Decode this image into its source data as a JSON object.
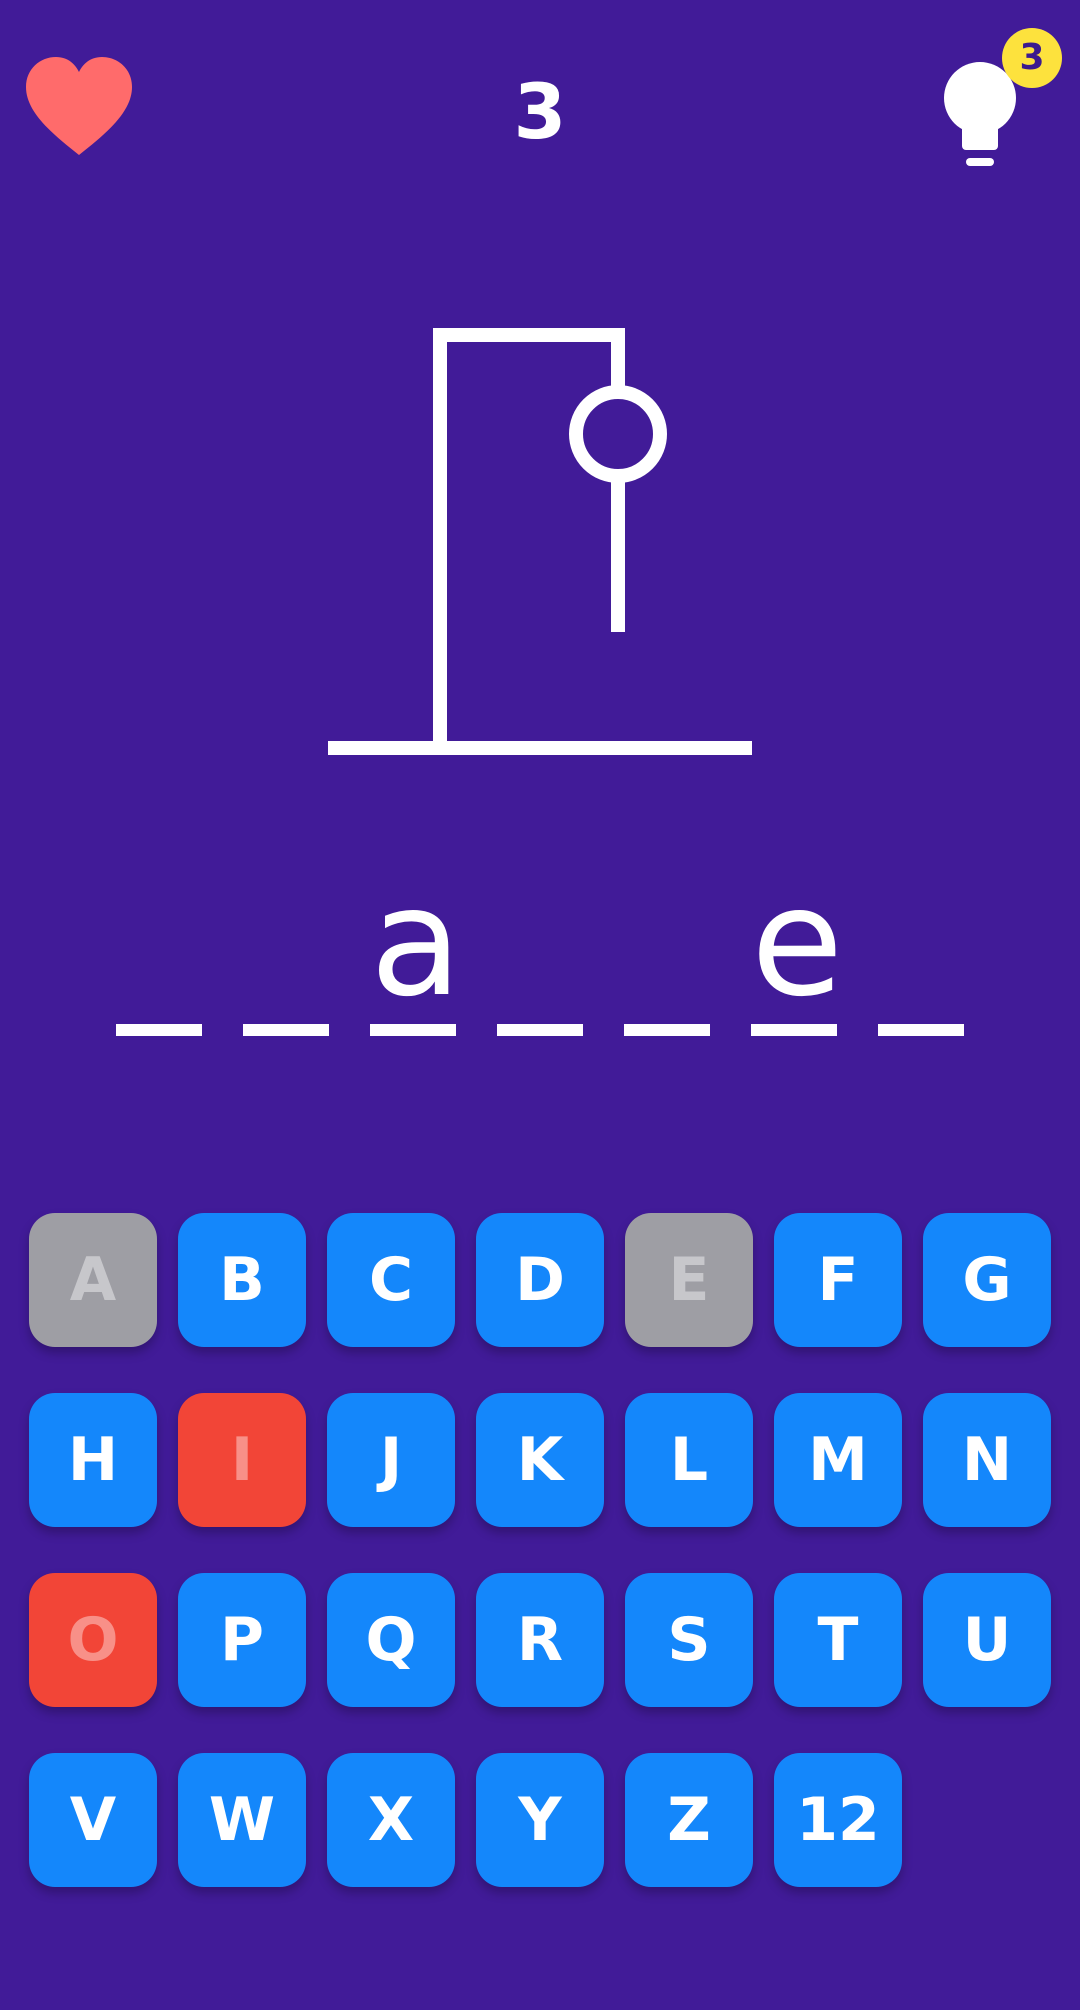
{
  "header": {
    "lives_icon": "heart-icon",
    "level": "3",
    "hint_icon": "lightbulb-icon",
    "hint_count": "3"
  },
  "colors": {
    "background": "#411b98",
    "key_available": "#1487fb",
    "key_revealed": "#9e9ea4",
    "key_wrong": "#f24537",
    "heart": "#ff6b6b",
    "hint_badge": "#fde23d"
  },
  "word": [
    "",
    "",
    "a",
    "",
    "",
    "e",
    ""
  ],
  "keyboard": [
    {
      "label": "A",
      "state": "revealed"
    },
    {
      "label": "B",
      "state": "available"
    },
    {
      "label": "C",
      "state": "available"
    },
    {
      "label": "D",
      "state": "available"
    },
    {
      "label": "E",
      "state": "revealed"
    },
    {
      "label": "F",
      "state": "available"
    },
    {
      "label": "G",
      "state": "available"
    },
    {
      "label": "H",
      "state": "available"
    },
    {
      "label": "I",
      "state": "wrong"
    },
    {
      "label": "J",
      "state": "available"
    },
    {
      "label": "K",
      "state": "available"
    },
    {
      "label": "L",
      "state": "available"
    },
    {
      "label": "M",
      "state": "available"
    },
    {
      "label": "N",
      "state": "available"
    },
    {
      "label": "O",
      "state": "wrong"
    },
    {
      "label": "P",
      "state": "available"
    },
    {
      "label": "Q",
      "state": "available"
    },
    {
      "label": "R",
      "state": "available"
    },
    {
      "label": "S",
      "state": "available"
    },
    {
      "label": "T",
      "state": "available"
    },
    {
      "label": "U",
      "state": "available"
    },
    {
      "label": "V",
      "state": "available"
    },
    {
      "label": "W",
      "state": "available"
    },
    {
      "label": "X",
      "state": "available"
    },
    {
      "label": "Y",
      "state": "available"
    },
    {
      "label": "Z",
      "state": "available"
    },
    {
      "label": "12",
      "state": "available"
    }
  ]
}
